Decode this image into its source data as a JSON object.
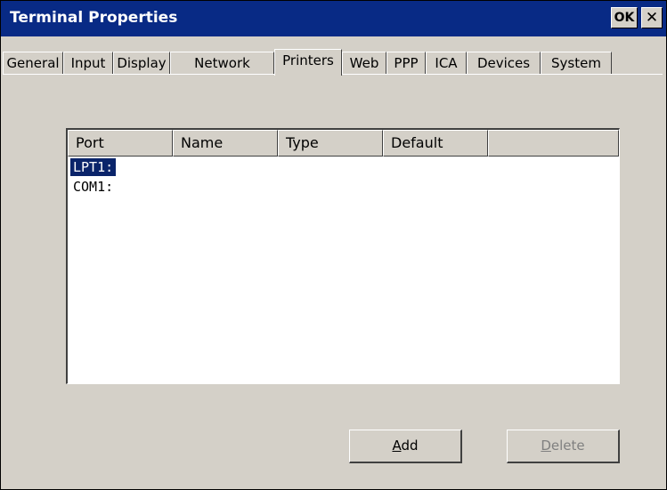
{
  "window": {
    "title": "Terminal Properties",
    "ok_label": "OK",
    "close_label": "✕"
  },
  "tabs": [
    {
      "label": "General"
    },
    {
      "label": "Input"
    },
    {
      "label": "Display"
    },
    {
      "label": "Network"
    },
    {
      "label": "Printers",
      "active": true
    },
    {
      "label": "Web"
    },
    {
      "label": "PPP"
    },
    {
      "label": "ICA"
    },
    {
      "label": "Devices"
    },
    {
      "label": "System"
    }
  ],
  "printers": {
    "columns": [
      "Port",
      "Name",
      "Type",
      "Default"
    ],
    "rows": [
      {
        "port": "LPT1:",
        "selected": true
      },
      {
        "port": "COM1:"
      }
    ]
  },
  "buttons": {
    "add": {
      "accel": "A",
      "rest": "dd"
    },
    "delete": {
      "accel": "D",
      "rest": "elete"
    }
  }
}
